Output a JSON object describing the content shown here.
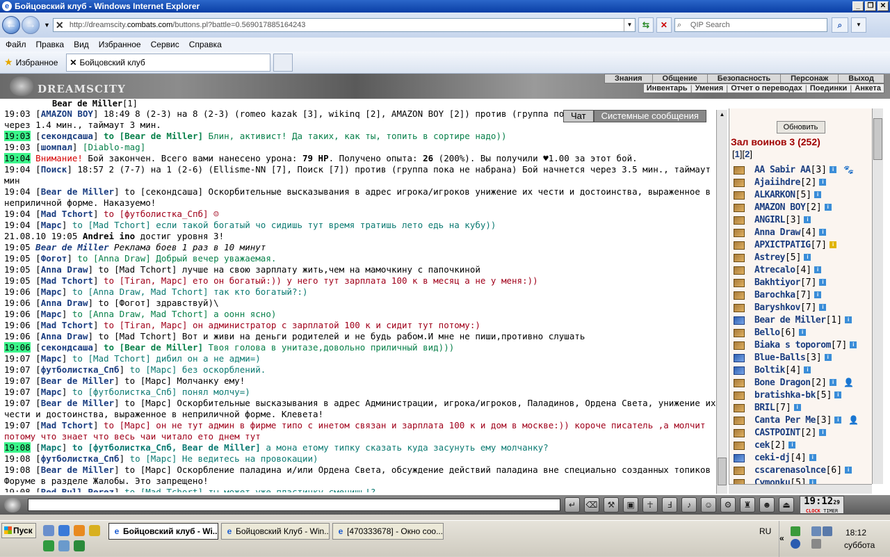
{
  "window": {
    "title": "Бойцовский клуб - Windows Internet Explorer",
    "controls": [
      "_",
      "❐",
      "✕"
    ]
  },
  "nav": {
    "url_pre": "http://dreamscity.",
    "url_domain": "combats.com",
    "url_post": "/buttons.pl?battle=0.569017885164243",
    "search_placeholder": "QIP Search"
  },
  "menu": [
    "Файл",
    "Правка",
    "Вид",
    "Избранное",
    "Сервис",
    "Справка"
  ],
  "favbar": {
    "favorites": "Избранное",
    "tab_title": "Бойцовский клуб"
  },
  "site": {
    "logo": "DREAMSCITY",
    "top_menu": [
      "Знания",
      "Общение",
      "Безопасность",
      "Персонаж",
      "Выход"
    ],
    "sub_menu": [
      "Инвентарь",
      "Умения",
      "Отчет о переводах",
      "Поединки",
      "Анкета"
    ],
    "top_name": "Bear de Miller",
    "top_name_level": "[1]",
    "chat_tabs": [
      "Чат",
      "Системные сообщения"
    ]
  },
  "chat": [
    {
      "t": "19:03",
      "n": "AMAZON BOY",
      "to": "",
      "m": " 18:49 8 (2-3) на 8 (2-3) (romeo kazak [3], wikinq [2], AMAZON BOY [2]) против (группа пока не набрана) Бой начнется через 1.4 мин., таймаут 3 мин.",
      "c": "bl"
    },
    {
      "t": "19:03",
      "hl": true,
      "n": "секондсаша",
      "to": " to [Bear de Miller]",
      "m": " Блин, активист! Да таких, как ты, топить в сортире надо))",
      "c": "gb"
    },
    {
      "t": "19:03",
      "n": "шомпал",
      "to": "",
      "m": " [Diablo-mag]",
      "c": "g"
    },
    {
      "t": "19:04",
      "hl": true,
      "sys": true,
      "m_pre": "Внимание!",
      "m": " Бой закончен. Всего вами нанесено урона: ",
      "b1": "79 HP",
      "m2": ". Получено опыта: ",
      "b2": "26",
      "m3": " (200%). Вы получили ♥1.00 за этот бой."
    },
    {
      "t": "19:04",
      "n": "Поиск",
      "to": "",
      "m": " 18:57 2 (7-7) на 1 (2-6) (Ellisme-NN [7], Поиск [7]) против (группа пока не набрана) Бой начнется через 3.5 мин., таймаут 2 мин",
      "c": "bl"
    },
    {
      "t": "19:04",
      "n": "Bear de Miller",
      "to": " to [секондсаша]",
      "m": " Оскорбительные высказывания в адрес игрока/игроков унижение их чести и достоинства, выраженное в неприличной форме. Наказуемо!",
      "c": "bl"
    },
    {
      "t": "19:04",
      "n": "Mad Tchort",
      "to": " to [футболистка_Спб]",
      "m": " ☺",
      "c": "r"
    },
    {
      "t": "19:04",
      "n": "Марс",
      "to": " to [Mad Tchort]",
      "m": " если такой богатый чо сидишь тут время тратишь лето едь на кубу))",
      "c": "t"
    },
    {
      "t": "21.08.10 19:05",
      "plain": true,
      "pb": "Andrei ino",
      "m": " достиг уровня 3!"
    },
    {
      "t": "19:05",
      "italic": true,
      "n": "Bear de Miller",
      "m": " Реклама боев 1 раз в 10 минут"
    },
    {
      "t": "19:05",
      "n": "Фогот",
      "to": " to [Anna Draw]",
      "m": " Добрый вечер уважаемая.",
      "c": "g"
    },
    {
      "t": "19:05",
      "n": "Anna Draw",
      "to": " to [Mad Tchort]",
      "m": " лучше на свою зарплату жить,чем на мамочкину с папочкиной",
      "c": "bl"
    },
    {
      "t": "19:05",
      "n": "Mad Tchort",
      "to": " to [Tiran, Марс]",
      "m": " ето он богатый:)) у него тут зарплата 100 к в месяц а не у меня:))",
      "c": "r"
    },
    {
      "t": "19:06",
      "n": "Марс",
      "to": " to [Anna Draw, Mad Tchort]",
      "m": " так кто богатый?:)",
      "c": "t"
    },
    {
      "t": "19:06",
      "n": "Anna Draw",
      "to": " to [Фогот]",
      "m": " здравствуй)\\",
      "c": "bl"
    },
    {
      "t": "19:06",
      "n": "Марс",
      "to": " to [Anna Draw, Mad Tchort]",
      "m": " а оонн ясно)",
      "c": "g"
    },
    {
      "t": "19:06",
      "n": "Mad Tchort",
      "to": " to [Tiran, Марс]",
      "m": " он администратор с зарплатой 100 к и сидит тут потому:)",
      "c": "r"
    },
    {
      "t": "19:06",
      "n": "Anna Draw",
      "to": " to [Mad Tchort]",
      "m": " Вот и живи на деньги родителей и не будь рабом.И мне не пиши,противно слушать",
      "c": "bl"
    },
    {
      "t": "19:06",
      "hl": true,
      "n": "секондсаша",
      "to": " to [Bear de Miller]",
      "m": " Твоя голова в унитазе,довольно приличный вид)))",
      "c": "gb"
    },
    {
      "t": "19:07",
      "n": "Марс",
      "to": " to [Mad Tchort]",
      "m": " дибил он а не адми=)",
      "c": "t"
    },
    {
      "t": "19:07",
      "n": "футболистка_Спб",
      "to": " to [Марс]",
      "m": " без оскорблений.",
      "c": "t"
    },
    {
      "t": "19:07",
      "n": "Bear de Miller",
      "to": " to [Марс]",
      "m": " Молчанку ему!",
      "c": "bl"
    },
    {
      "t": "19:07",
      "n": "Марс",
      "to": " to [футболистка_Спб]",
      "m": " понял молчу=)",
      "c": "t"
    },
    {
      "t": "19:07",
      "n": "Bear de Miller",
      "to": " to [Марс]",
      "m": " Оскорбительные высказывания в адрес Администрации, игрока/игроков, Паладинов, Ордена Света, унижение их чести и достоинства, выраженное в неприличной форме. Клевета!",
      "c": "bl"
    },
    {
      "t": "19:07",
      "n": "Mad Tchort",
      "to": " to [Марс]",
      "m": " он не тут админ в фирме типо с инетом связан и зарплата 100 к и дом в москве:)) короче писатель ,а молчит потому что знает что весь чаи читало ето днем тут",
      "c": "r"
    },
    {
      "t": "19:08",
      "hl": true,
      "n": "Марс",
      "to": " to [футболистка_Спб, Bear de Miller]",
      "m": " а мона етому типку сказать куда засунуть ему молчанку?",
      "c": "t2"
    },
    {
      "t": "19:08",
      "n": "футболистка_Спб",
      "to": " to [Марс]",
      "m": " Не ведитесь на провокации)",
      "c": "t"
    },
    {
      "t": "19:08",
      "n": "Bear de Miller",
      "to": " to [Марс]",
      "m": " Оскорбление паладина и/или Ордена Света, обсуждение действий паладина вне специально созданных топиков на Форуме в разделе Жалобы. Это запрещено!",
      "c": "bl"
    },
    {
      "t": "19:08",
      "n": "Red Bull Perez",
      "to": " to [Mad Tchort]",
      "m": " ты может уже пластинку сменишь!?",
      "c": "t"
    }
  ],
  "panel": {
    "refresh_label": "Обновить",
    "hall_title": "Зал воинов 3 (252)",
    "pages_open": "[",
    "pages": [
      "1",
      "2"
    ],
    "users": [
      {
        "name": "AA Sabir AA",
        "lvl": "[3]",
        "extra": "🐾"
      },
      {
        "name": "Ajaiihdre",
        "lvl": "[2]"
      },
      {
        "name": "ALKARKON",
        "lvl": "[5]"
      },
      {
        "name": "AMAZON BOY",
        "lvl": "[2]"
      },
      {
        "name": "ANGIRL",
        "lvl": "[3]"
      },
      {
        "name": "Anna Draw",
        "lvl": "[4]"
      },
      {
        "name": "АРХІСТРАТІG",
        "lvl": "[7]",
        "y": true
      },
      {
        "name": "Astrey",
        "lvl": "[5]"
      },
      {
        "name": "Atrecalo",
        "lvl": "[4]"
      },
      {
        "name": "Bakhtiyor",
        "lvl": "[7]"
      },
      {
        "name": "Barochka",
        "lvl": "[7]"
      },
      {
        "name": "Baryshkov",
        "lvl": "[7]"
      },
      {
        "name": "Bear de Miller",
        "lvl": "[1]",
        "blue": true
      },
      {
        "name": "Bello",
        "lvl": "[6]"
      },
      {
        "name": "Biaka s toporom",
        "lvl": "[7]"
      },
      {
        "name": "Blue-Balls",
        "lvl": "[3]",
        "blue": true
      },
      {
        "name": "Boltik",
        "lvl": "[4]",
        "blue": true
      },
      {
        "name": "Bone Dragon",
        "lvl": "[2]",
        "extra": "👤"
      },
      {
        "name": "bratishka-bk",
        "lvl": "[5]"
      },
      {
        "name": "BRIL",
        "lvl": "[7]"
      },
      {
        "name": "Canta Per Me",
        "lvl": "[3]",
        "extra": "👤"
      },
      {
        "name": "CASTPOINT",
        "lvl": "[2]"
      },
      {
        "name": "cek",
        "lvl": "[2]"
      },
      {
        "name": "ceki-dj",
        "lvl": "[4]",
        "blue": true
      },
      {
        "name": "cscarenasolnce",
        "lvl": "[6]"
      },
      {
        "name": "Cymonku",
        "lvl": "[5]"
      }
    ]
  },
  "bottom": {
    "clock_time": "19:12",
    "clock_sec": "29",
    "clock_l1": "CLOCK",
    "clock_l2": "TIMER"
  },
  "taskbar": {
    "start": "Пуск",
    "tasks": [
      "Бойцовский клуб - Wi...",
      "Бойцовский Клуб - Win...",
      "[470333678] - Окно соо..."
    ],
    "lang": "RU",
    "time": "18:12",
    "day": "суббота"
  }
}
